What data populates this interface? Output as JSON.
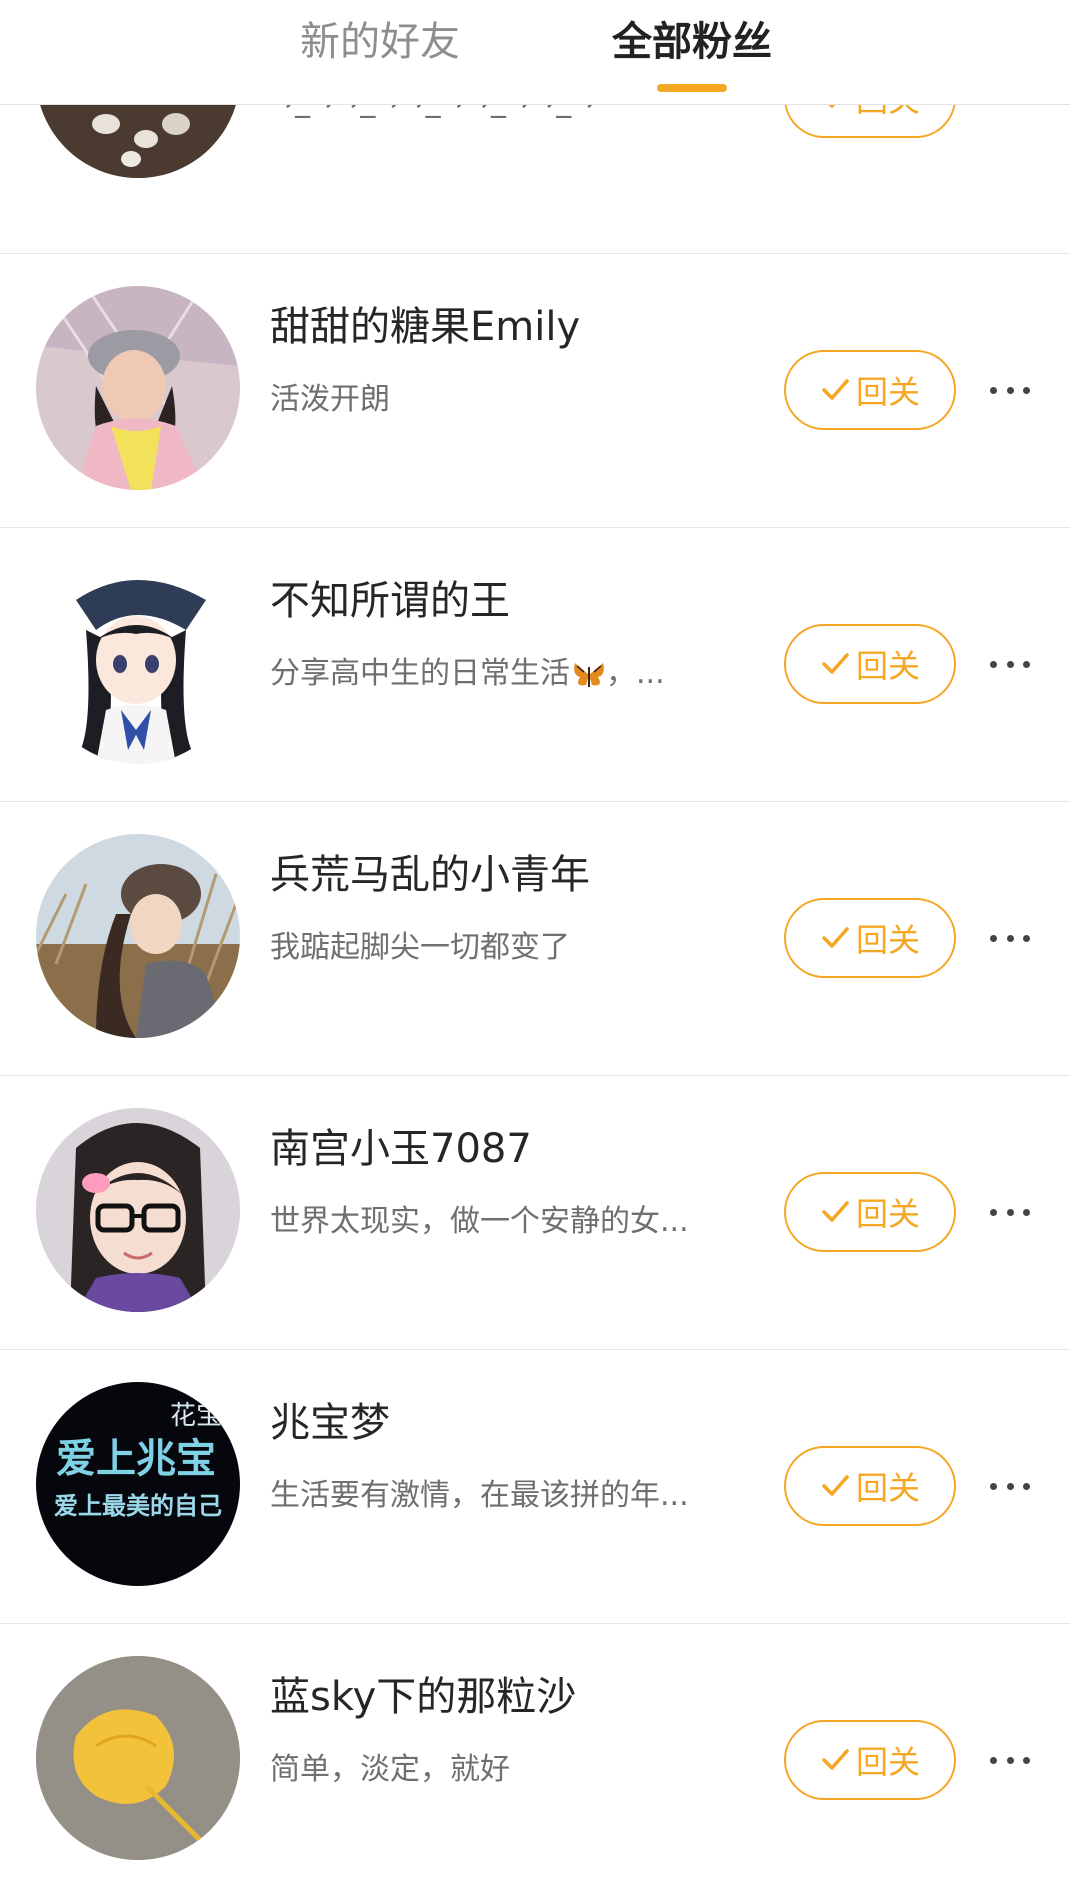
{
  "tabs": {
    "new_friends": "新的好友",
    "all_fans": "全部粉丝"
  },
  "colors": {
    "accent": "#f5a623",
    "name_text": "#262626",
    "desc_text": "#6f6f6f"
  },
  "follow_back_label": "回关",
  "fans": [
    {
      "name": "",
      "desc": "→_→→_→→_→→_→→_→",
      "avatar": "tea-table-photo"
    },
    {
      "name": "甜甜的糖果Emily",
      "desc": "活泼开朗",
      "avatar": "girl-in-hat-photo"
    },
    {
      "name": "不知所谓的王",
      "desc": "分享高中生的日常生活",
      "desc_suffix": "，...",
      "avatar": "anime-girl-drawing"
    },
    {
      "name": "兵荒马乱的小青年",
      "desc": "我踮起脚尖一切都变了",
      "avatar": "girl-in-grass-photo"
    },
    {
      "name": "南宫小玉7087",
      "desc": "世界太现实，做一个安静的女...",
      "avatar": "girl-with-glasses-photo"
    },
    {
      "name": "兆宝梦",
      "desc": "生活要有激情，在最该拼的年...",
      "avatar": "text-graphic",
      "avatar_text_line1": "爱上兆宝",
      "avatar_text_line2": "爱上最美的自己",
      "avatar_text_corner": "花宝"
    },
    {
      "name": "蓝sky下的那粒沙",
      "desc": "简单，淡定，就好",
      "avatar": "ginkgo-leaf-photo"
    }
  ]
}
